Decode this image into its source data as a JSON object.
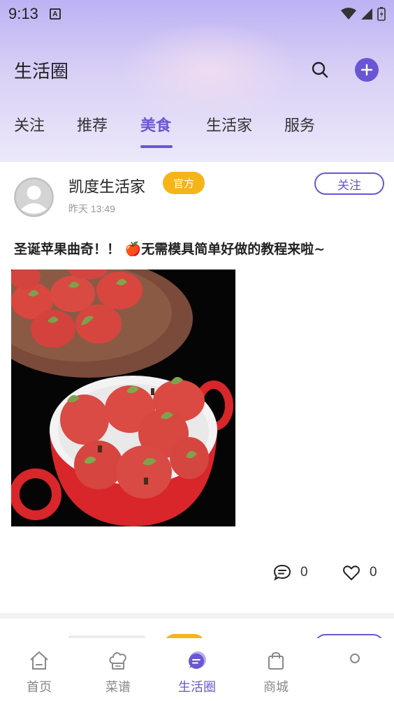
{
  "status_bar": {
    "time": "9:13",
    "notif_letter": "A"
  },
  "header": {
    "title": "生活圈"
  },
  "tabs": [
    {
      "label": "关注",
      "active": false
    },
    {
      "label": "推荐",
      "active": false
    },
    {
      "label": "美食",
      "active": true
    },
    {
      "label": "生活家",
      "active": false
    },
    {
      "label": "服务",
      "active": false
    }
  ],
  "post": {
    "author_name": "凯度生活家",
    "badge": "官方",
    "time": "昨天 13:49",
    "follow_label": "关注",
    "title": "圣诞苹果曲奇！！ 🍎无需模具简单好做的教程来啦~",
    "comment_count": "0",
    "like_count": "0"
  },
  "bottom_nav": [
    {
      "label": "首页",
      "icon": "home-icon",
      "active": false
    },
    {
      "label": "菜谱",
      "icon": "chef-hat-icon",
      "active": false
    },
    {
      "label": "生活圈",
      "icon": "chat-bubble-icon",
      "active": true
    },
    {
      "label": "商城",
      "icon": "shopping-bag-icon",
      "active": false
    }
  ],
  "colors": {
    "accent": "#6a56d4",
    "badge": "#f5b418"
  }
}
